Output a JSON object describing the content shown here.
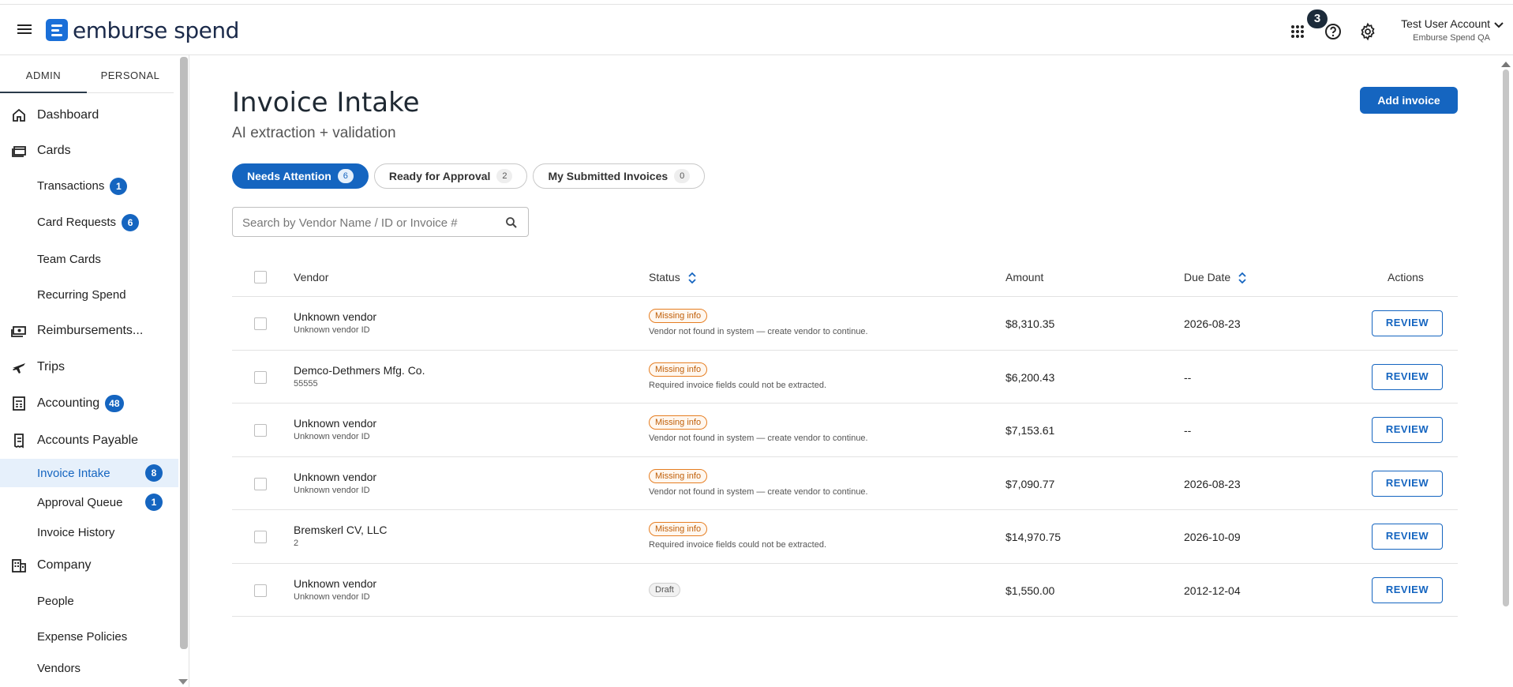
{
  "header": {
    "logo_text_a": "emburse",
    "logo_text_b": " spend",
    "notification_count": "3",
    "account_name": "Test User Account",
    "account_org": "Emburse Spend QA"
  },
  "sidebar": {
    "role_tabs": [
      "ADMIN",
      "PERSONAL"
    ],
    "items": [
      {
        "label": "Dashboard",
        "icon": "home-icon"
      },
      {
        "label": "Cards",
        "icon": "cards-icon"
      },
      {
        "label": "Transactions",
        "badge": "1"
      },
      {
        "label": "Card Requests",
        "badge": "6"
      },
      {
        "label": "Team Cards"
      },
      {
        "label": "Recurring Spend"
      },
      {
        "label": "Reimbursements...",
        "icon": "cash-icon"
      },
      {
        "label": "Trips",
        "icon": "plane-icon"
      },
      {
        "label": "Accounting",
        "icon": "calculator-icon",
        "badge": "48"
      },
      {
        "label": "Accounts Payable",
        "icon": "receipt-icon"
      },
      {
        "label": "Invoice Intake",
        "badge": "8",
        "active": true
      },
      {
        "label": "Approval Queue",
        "badge": "1"
      },
      {
        "label": "Invoice History"
      },
      {
        "label": "Company",
        "icon": "building-icon"
      },
      {
        "label": "People"
      },
      {
        "label": "Expense Policies"
      },
      {
        "label": "Vendors"
      }
    ]
  },
  "page": {
    "title": "Invoice Intake",
    "subtitle": "AI extraction + validation",
    "add_button": "Add invoice"
  },
  "filters": [
    {
      "label": "Needs Attention",
      "count": "6",
      "active": true
    },
    {
      "label": "Ready for Approval",
      "count": "2"
    },
    {
      "label": "My Submitted Invoices",
      "count": "0"
    }
  ],
  "search": {
    "placeholder": "Search by Vendor Name / ID or Invoice #",
    "value": ""
  },
  "table": {
    "columns": {
      "vendor": "Vendor",
      "status": "Status",
      "amount": "Amount",
      "due_date": "Due Date",
      "actions": "Actions"
    },
    "action_label": "REVIEW",
    "rows": [
      {
        "vendor": "Unknown vendor",
        "vendor_id": "Unknown vendor ID",
        "status": "Missing info",
        "status_type": "missing",
        "note": "Vendor not found in system — create vendor to continue.",
        "amount": "$8,310.35",
        "due": "2026-08-23"
      },
      {
        "vendor": "Demco-Dethmers Mfg. Co.",
        "vendor_id": "55555",
        "status": "Missing info",
        "status_type": "missing",
        "note": "Required invoice fields could not be extracted.",
        "amount": "$6,200.43",
        "due": "--"
      },
      {
        "vendor": "Unknown vendor",
        "vendor_id": "Unknown vendor ID",
        "status": "Missing info",
        "status_type": "missing",
        "note": "Vendor not found in system — create vendor to continue.",
        "amount": "$7,153.61",
        "due": "--"
      },
      {
        "vendor": "Unknown vendor",
        "vendor_id": "Unknown vendor ID",
        "status": "Missing info",
        "status_type": "missing",
        "note": "Vendor not found in system — create vendor to continue.",
        "amount": "$7,090.77",
        "due": "2026-08-23"
      },
      {
        "vendor": "Bremskerl CV, LLC",
        "vendor_id": "2",
        "status": "Missing info",
        "status_type": "missing",
        "note": "Required invoice fields could not be extracted.",
        "amount": "$14,970.75",
        "due": "2026-10-09"
      },
      {
        "vendor": "Unknown vendor",
        "vendor_id": "Unknown vendor ID",
        "status": "Draft",
        "status_type": "draft",
        "note": "",
        "amount": "$1,550.00",
        "due": "2012-12-04"
      }
    ]
  },
  "colors": {
    "brand": "#1565c0",
    "missing_border": "#e67e22",
    "active_bg": "#e6f0fb"
  }
}
